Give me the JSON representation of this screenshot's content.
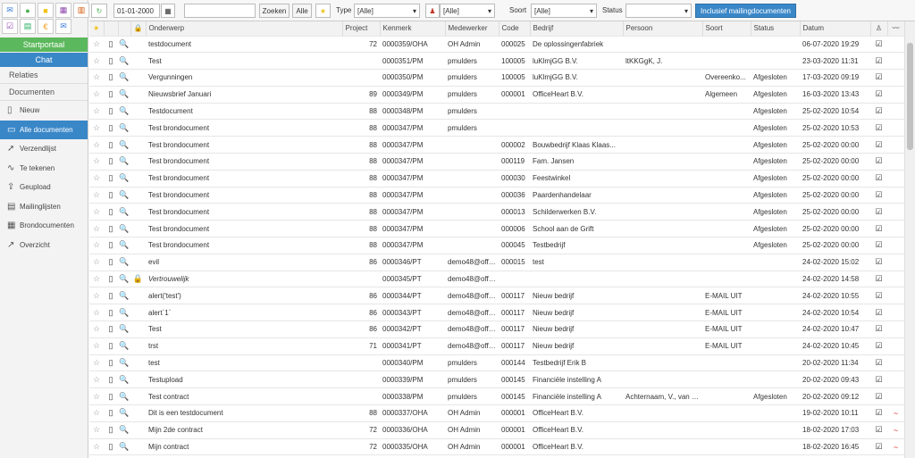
{
  "sidebar": {
    "startportaal": "Startportaal",
    "chat": "Chat",
    "sections": [
      "Relaties",
      "Documenten"
    ],
    "items": [
      {
        "label": "Nieuw",
        "icon": "file-icon"
      },
      {
        "label": "Alle documenten",
        "icon": "files-icon",
        "active": true
      },
      {
        "label": "Verzendlijst",
        "icon": "send-icon"
      },
      {
        "label": "Te tekenen",
        "icon": "signature-icon"
      },
      {
        "label": "Geupload",
        "icon": "upload-icon"
      },
      {
        "label": "Mailinglijsten",
        "icon": "mailing-icon"
      },
      {
        "label": "Brondocumenten",
        "icon": "source-icon"
      },
      {
        "label": "Overzicht",
        "icon": "chart-icon"
      }
    ]
  },
  "toolbar": {
    "date": "01-01-2000",
    "zoeken": "Zoeken",
    "alle": "Alle",
    "type_label": "Type",
    "type_value": "[Alle]",
    "user_value": "[Alle]",
    "soort_label": "Soort",
    "soort_value": "[Alle]",
    "status_label": "Status",
    "status_value": "",
    "mailing_button": "Inclusief mailingdocumenten"
  },
  "columns": [
    "Onderwerp",
    "Project",
    "Kenmerk",
    "Medewerker",
    "Code",
    "Bedrijf",
    "Persoon",
    "Soort",
    "Status",
    "Datum"
  ],
  "rows": [
    {
      "onderwerp": "testdocument",
      "project": "72",
      "kenmerk": "0000359/OHA",
      "medewerker": "OH Admin",
      "code": "000025",
      "bedrijf": "De oplossingenfabriek",
      "persoon": "",
      "soort": "",
      "status": "",
      "datum": "06-07-2020 19:29",
      "sig": ""
    },
    {
      "onderwerp": "Test",
      "project": "",
      "kenmerk": "0000351/PM",
      "medewerker": "pmulders",
      "code": "100005",
      "bedrijf": "luKlmjGG B.V.",
      "persoon": "ltKKGgK, J.",
      "soort": "",
      "status": "",
      "datum": "23-03-2020 11:31",
      "sig": ""
    },
    {
      "onderwerp": "Vergunningen",
      "project": "",
      "kenmerk": "0000350/PM",
      "medewerker": "pmulders",
      "code": "100005",
      "bedrijf": "luKlmjGG B.V.",
      "persoon": "",
      "soort": "Overeenko...",
      "status": "Afgesloten",
      "datum": "17-03-2020 09:19",
      "sig": ""
    },
    {
      "onderwerp": "Nieuwsbrief Januari",
      "project": "89",
      "kenmerk": "0000349/PM",
      "medewerker": "pmulders",
      "code": "000001",
      "bedrijf": "OfficeHeart B.V.",
      "persoon": "",
      "soort": "Algemeen",
      "status": "Afgesloten",
      "datum": "16-03-2020 13:43",
      "sig": ""
    },
    {
      "onderwerp": "Testdocument",
      "project": "88",
      "kenmerk": "0000348/PM",
      "medewerker": "pmulders",
      "code": "",
      "bedrijf": "",
      "persoon": "",
      "soort": "",
      "status": "Afgesloten",
      "datum": "25-02-2020 10:54",
      "sig": ""
    },
    {
      "onderwerp": "Test brondocument",
      "project": "88",
      "kenmerk": "0000347/PM",
      "medewerker": "pmulders",
      "code": "",
      "bedrijf": "",
      "persoon": "",
      "soort": "",
      "status": "Afgesloten",
      "datum": "25-02-2020 10:53",
      "sig": ""
    },
    {
      "onderwerp": "Test brondocument",
      "project": "88",
      "kenmerk": "0000347/PM",
      "medewerker": "",
      "code": "000002",
      "bedrijf": "Bouwbedrijf Klaas Klaas...",
      "persoon": "",
      "soort": "",
      "status": "Afgesloten",
      "datum": "25-02-2020 00:00",
      "sig": ""
    },
    {
      "onderwerp": "Test brondocument",
      "project": "88",
      "kenmerk": "0000347/PM",
      "medewerker": "",
      "code": "000119",
      "bedrijf": "Fam. Jansen",
      "persoon": "",
      "soort": "",
      "status": "Afgesloten",
      "datum": "25-02-2020 00:00",
      "sig": ""
    },
    {
      "onderwerp": "Test brondocument",
      "project": "88",
      "kenmerk": "0000347/PM",
      "medewerker": "",
      "code": "000030",
      "bedrijf": "Feestwinkel",
      "persoon": "",
      "soort": "",
      "status": "Afgesloten",
      "datum": "25-02-2020 00:00",
      "sig": ""
    },
    {
      "onderwerp": "Test brondocument",
      "project": "88",
      "kenmerk": "0000347/PM",
      "medewerker": "",
      "code": "000036",
      "bedrijf": "Paardenhandelaar",
      "persoon": "",
      "soort": "",
      "status": "Afgesloten",
      "datum": "25-02-2020 00:00",
      "sig": ""
    },
    {
      "onderwerp": "Test brondocument",
      "project": "88",
      "kenmerk": "0000347/PM",
      "medewerker": "",
      "code": "000013",
      "bedrijf": "Schilderwerken B.V.",
      "persoon": "",
      "soort": "",
      "status": "Afgesloten",
      "datum": "25-02-2020 00:00",
      "sig": ""
    },
    {
      "onderwerp": "Test brondocument",
      "project": "88",
      "kenmerk": "0000347/PM",
      "medewerker": "",
      "code": "000006",
      "bedrijf": "School aan de Grift",
      "persoon": "",
      "soort": "",
      "status": "Afgesloten",
      "datum": "25-02-2020 00:00",
      "sig": ""
    },
    {
      "onderwerp": "Test brondocument",
      "project": "88",
      "kenmerk": "0000347/PM",
      "medewerker": "",
      "code": "000045",
      "bedrijf": "Testbedrijf",
      "persoon": "",
      "soort": "",
      "status": "Afgesloten",
      "datum": "25-02-2020 00:00",
      "sig": ""
    },
    {
      "onderwerp": "evil",
      "project": "86",
      "kenmerk": "0000346/PT",
      "medewerker": "demo48@offi...",
      "code": "000015",
      "bedrijf": "test",
      "persoon": "",
      "soort": "",
      "status": "",
      "datum": "24-02-2020 15:02",
      "sig": ""
    },
    {
      "onderwerp": "Vertrouwelijk",
      "project": "",
      "kenmerk": "0000345/PT",
      "medewerker": "demo48@offi...",
      "code": "",
      "bedrijf": "",
      "persoon": "",
      "soort": "",
      "status": "",
      "datum": "24-02-2020 14:58",
      "sig": "",
      "italic": true
    },
    {
      "onderwerp": "alert('test')",
      "project": "86",
      "kenmerk": "0000344/PT",
      "medewerker": "demo48@offi...",
      "code": "000117",
      "bedrijf": "Nieuw bedrijf",
      "persoon": "",
      "soort": "E-MAIL UIT",
      "status": "",
      "datum": "24-02-2020 10:55",
      "sig": ""
    },
    {
      "onderwerp": "alert`1`",
      "project": "86",
      "kenmerk": "0000343/PT",
      "medewerker": "demo48@offi...",
      "code": "000117",
      "bedrijf": "Nieuw bedrijf",
      "persoon": "",
      "soort": "E-MAIL UIT",
      "status": "",
      "datum": "24-02-2020 10:54",
      "sig": ""
    },
    {
      "onderwerp": "Test",
      "project": "86",
      "kenmerk": "0000342/PT",
      "medewerker": "demo48@offi...",
      "code": "000117",
      "bedrijf": "Nieuw bedrijf",
      "persoon": "",
      "soort": "E-MAIL UIT",
      "status": "",
      "datum": "24-02-2020 10:47",
      "sig": ""
    },
    {
      "onderwerp": "trst",
      "project": "71",
      "kenmerk": "0000341/PT",
      "medewerker": "demo48@offi...",
      "code": "000117",
      "bedrijf": "Nieuw bedrijf",
      "persoon": "",
      "soort": "E-MAIL UIT",
      "status": "",
      "datum": "24-02-2020 10:45",
      "sig": ""
    },
    {
      "onderwerp": "test",
      "project": "",
      "kenmerk": "0000340/PM",
      "medewerker": "pmulders",
      "code": "000144",
      "bedrijf": "Testbedrijf Erik B",
      "persoon": "",
      "soort": "",
      "status": "",
      "datum": "20-02-2020 11:34",
      "sig": ""
    },
    {
      "onderwerp": "Testupload",
      "project": "",
      "kenmerk": "0000339/PM",
      "medewerker": "pmulders",
      "code": "000145",
      "bedrijf": "Financiële instelling A",
      "persoon": "",
      "soort": "",
      "status": "",
      "datum": "20-02-2020 09:43",
      "sig": ""
    },
    {
      "onderwerp": "Test contract",
      "project": "",
      "kenmerk": "0000338/PM",
      "medewerker": "pmulders",
      "code": "000145",
      "bedrijf": "Financiële instelling A",
      "persoon": "Achternaam, V., van d...",
      "soort": "",
      "status": "Afgesloten",
      "datum": "20-02-2020 09:12",
      "sig": ""
    },
    {
      "onderwerp": "Dit is een testdocument",
      "project": "88",
      "kenmerk": "0000337/OHA",
      "medewerker": "OH Admin",
      "code": "000001",
      "bedrijf": "OfficeHeart B.V.",
      "persoon": "",
      "soort": "",
      "status": "",
      "datum": "19-02-2020 10:11",
      "sig": "~"
    },
    {
      "onderwerp": "Mijn 2de contract",
      "project": "72",
      "kenmerk": "0000336/OHA",
      "medewerker": "OH Admin",
      "code": "000001",
      "bedrijf": "OfficeHeart B.V.",
      "persoon": "",
      "soort": "",
      "status": "",
      "datum": "18-02-2020 17:03",
      "sig": "~"
    },
    {
      "onderwerp": "Mijn contract",
      "project": "72",
      "kenmerk": "0000335/OHA",
      "medewerker": "OH Admin",
      "code": "000001",
      "bedrijf": "OfficeHeart B.V.",
      "persoon": "",
      "soort": "",
      "status": "",
      "datum": "18-02-2020 16:45",
      "sig": "~"
    }
  ],
  "colors": {
    "accent": "#3a87c8",
    "green": "#5cb85c",
    "signature": "#d22222"
  }
}
